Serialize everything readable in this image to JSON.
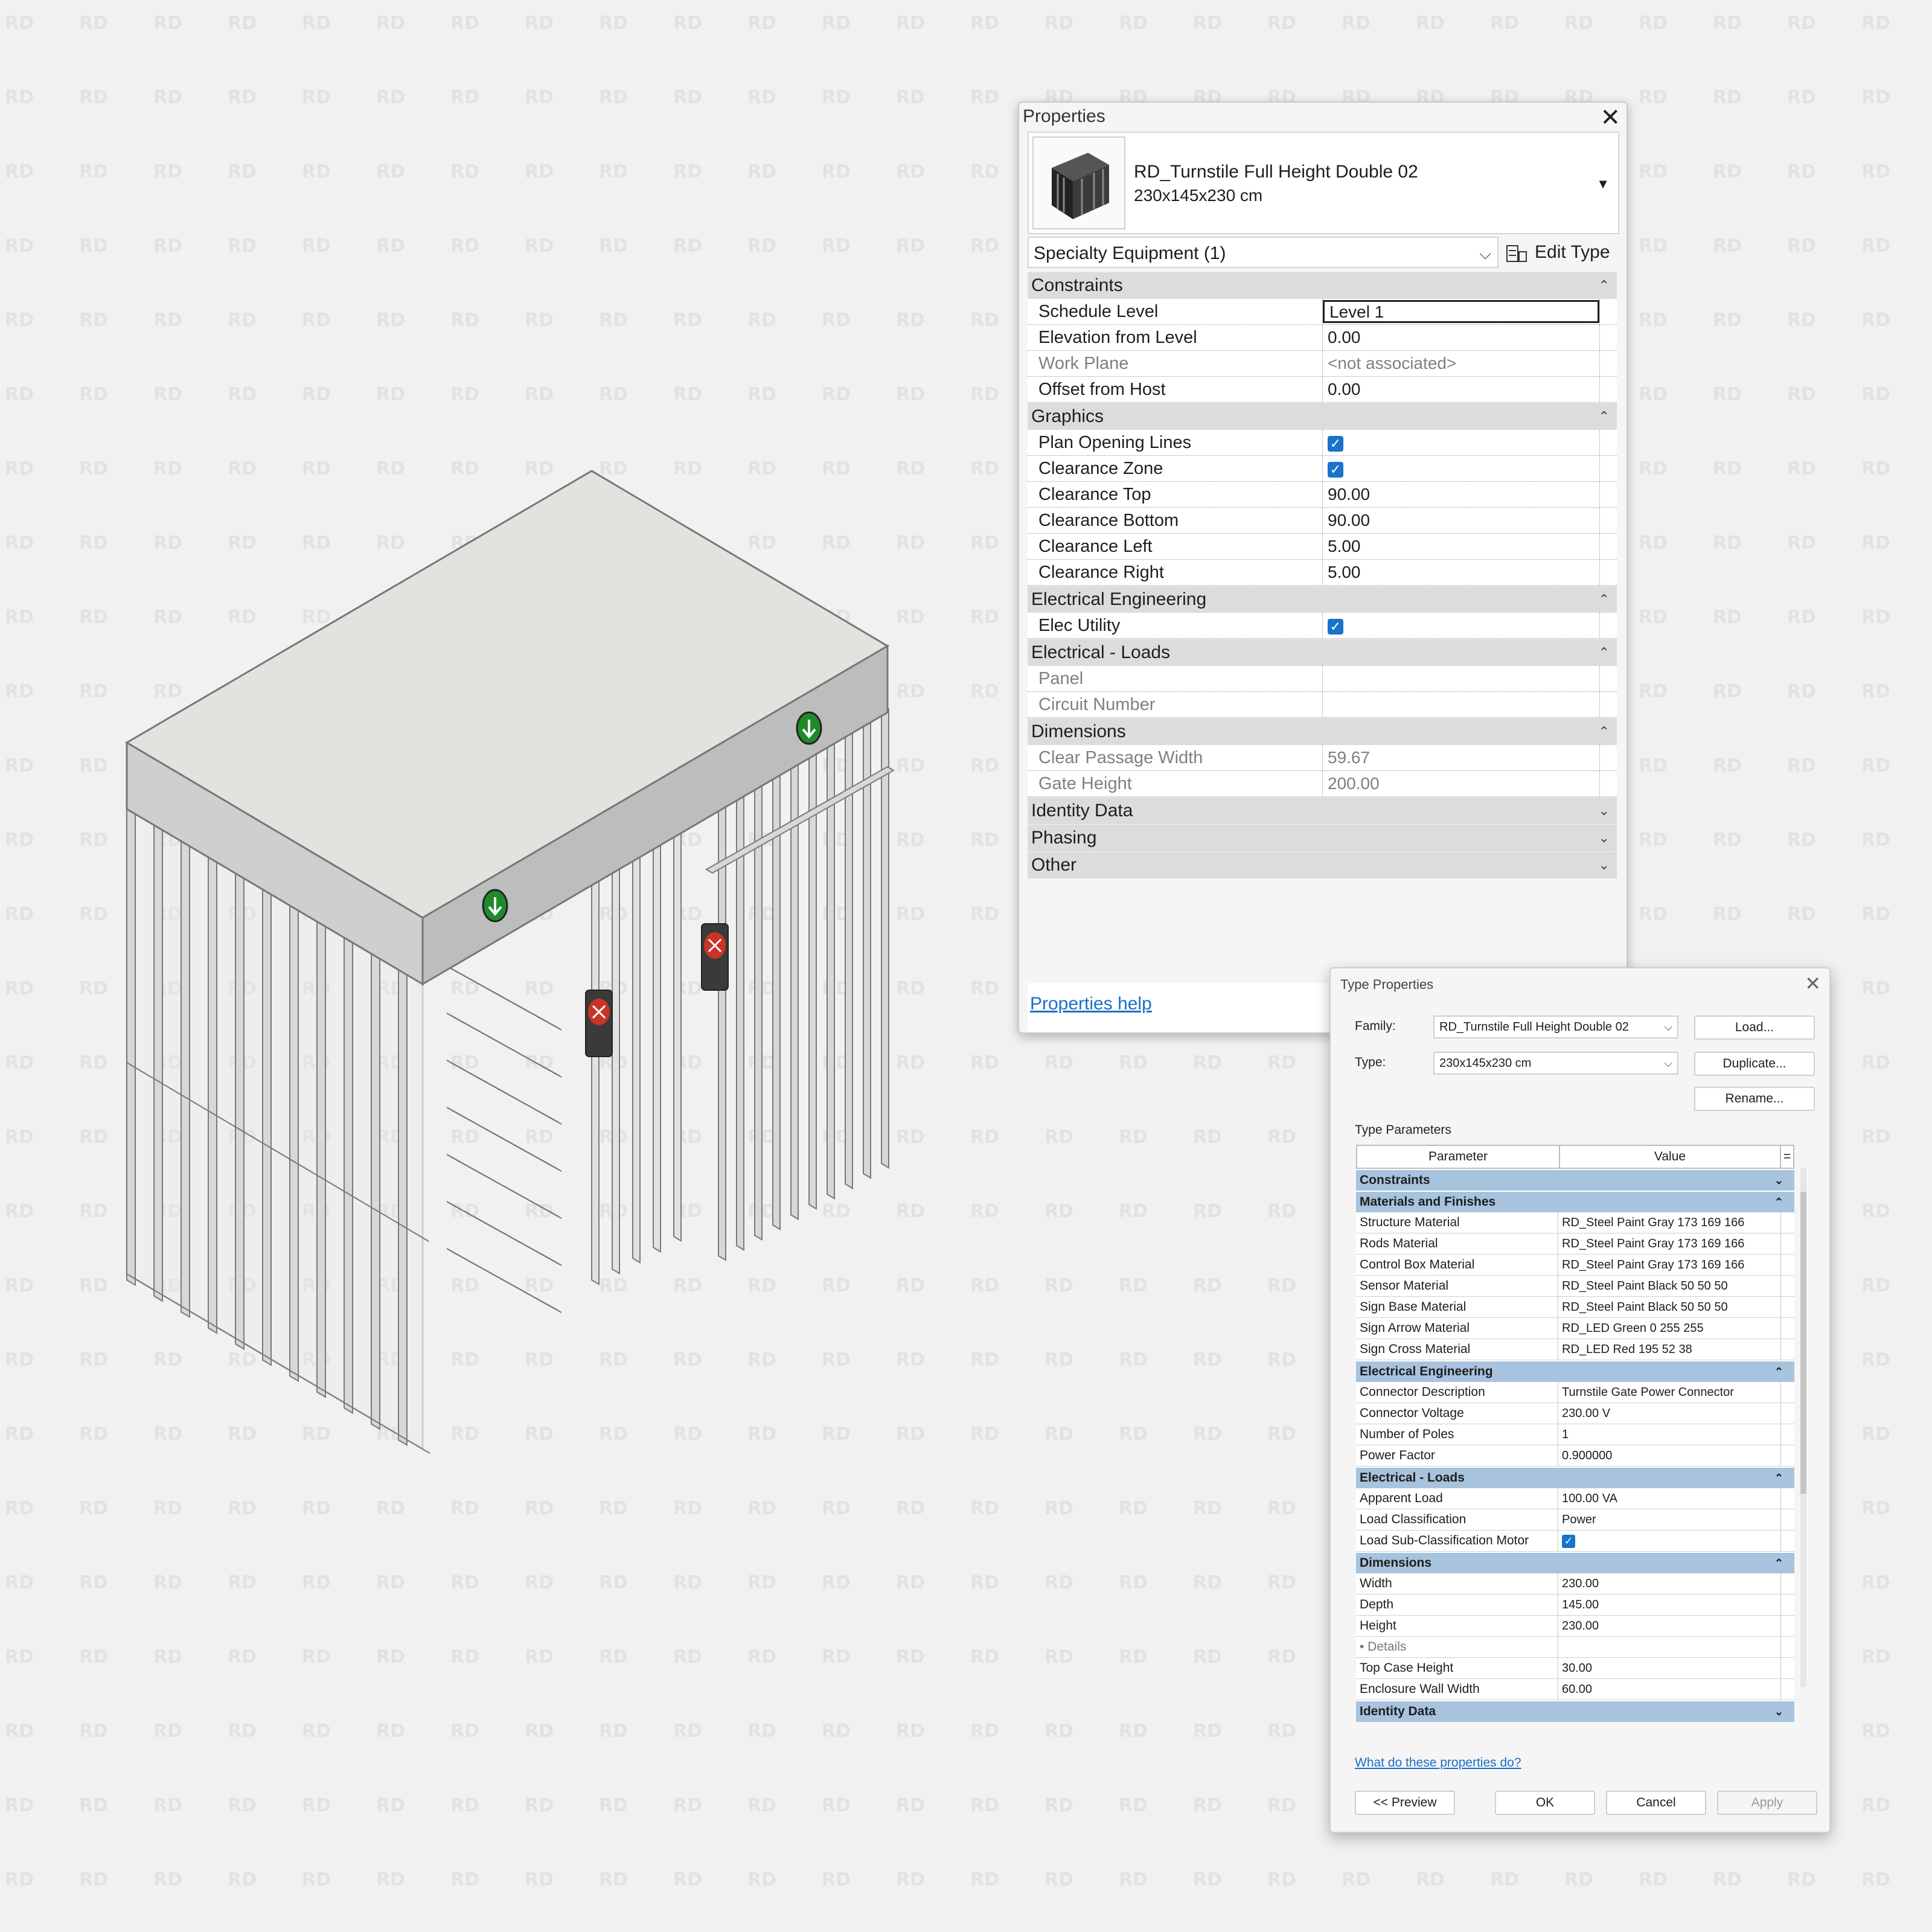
{
  "watermark": "RD",
  "properties": {
    "title": "Properties",
    "type_name": "RD_Turnstile Full Height Double 02",
    "type_size": "230x145x230 cm",
    "category_select": "Specialty Equipment (1)",
    "edit_type_label": "Edit Type",
    "help_link": "Properties help",
    "groups": {
      "constraints": "Constraints",
      "graphics": "Graphics",
      "electrical_engineering": "Electrical Engineering",
      "electrical_loads": "Electrical - Loads",
      "dimensions": "Dimensions",
      "identity_data": "Identity Data",
      "phasing": "Phasing",
      "other": "Other"
    },
    "rows": {
      "schedule_level": {
        "label": "Schedule Level",
        "value": "Level 1"
      },
      "elevation_from_level": {
        "label": "Elevation from Level",
        "value": "0.00"
      },
      "work_plane": {
        "label": "Work Plane",
        "value": "<not associated>"
      },
      "offset_from_host": {
        "label": "Offset from Host",
        "value": "0.00"
      },
      "plan_opening_lines": {
        "label": "Plan Opening Lines",
        "checked": true
      },
      "clearance_zone": {
        "label": "Clearance Zone",
        "checked": true
      },
      "clearance_top": {
        "label": "Clearance Top",
        "value": "90.00"
      },
      "clearance_bottom": {
        "label": "Clearance Bottom",
        "value": "90.00"
      },
      "clearance_left": {
        "label": "Clearance Left",
        "value": "5.00"
      },
      "clearance_right": {
        "label": "Clearance Right",
        "value": "5.00"
      },
      "elec_utility": {
        "label": "Elec Utility",
        "checked": true
      },
      "panel": {
        "label": "Panel",
        "value": ""
      },
      "circuit_number": {
        "label": "Circuit Number",
        "value": ""
      },
      "clear_passage_width": {
        "label": "Clear Passage Width",
        "value": "59.67"
      },
      "gate_height": {
        "label": "Gate Height",
        "value": "200.00"
      }
    }
  },
  "type_properties": {
    "title": "Type Properties",
    "family_label": "Family:",
    "family_value": "RD_Turnstile Full Height Double 02",
    "type_label": "Type:",
    "type_value": "230x145x230 cm",
    "load_button": "Load...",
    "duplicate_button": "Duplicate...",
    "rename_button": "Rename...",
    "type_parameters_label": "Type Parameters",
    "col_parameter": "Parameter",
    "col_value": "Value",
    "col_equals": "=",
    "groups": {
      "constraints": "Constraints",
      "materials": "Materials and Finishes",
      "electrical_engineering": "Electrical Engineering",
      "electrical_loads": "Electrical - Loads",
      "dimensions": "Dimensions",
      "identity_data": "Identity Data"
    },
    "materials_rows": [
      {
        "label": "Structure Material",
        "value": "RD_Steel Paint Gray 173 169 166"
      },
      {
        "label": "Rods Material",
        "value": "RD_Steel Paint Gray 173 169 166"
      },
      {
        "label": "Control Box Material",
        "value": "RD_Steel Paint Gray 173 169 166"
      },
      {
        "label": "Sensor Material",
        "value": "RD_Steel Paint Black 50 50 50"
      },
      {
        "label": "Sign Base Material",
        "value": "RD_Steel Paint Black 50 50 50"
      },
      {
        "label": "Sign Arrow Material",
        "value": "RD_LED Green 0 255 255"
      },
      {
        "label": "Sign Cross Material",
        "value": "RD_LED Red 195 52 38"
      }
    ],
    "electrical_rows": [
      {
        "label": "Connector Description",
        "value": "Turnstile Gate Power Connector"
      },
      {
        "label": "Connector Voltage",
        "value": "230.00 V"
      },
      {
        "label": "Number of Poles",
        "value": "1"
      },
      {
        "label": "Power Factor",
        "value": "0.900000"
      }
    ],
    "loads_rows": {
      "apparent_load": {
        "label": "Apparent Load",
        "value": "100.00 VA"
      },
      "load_classification": {
        "label": "Load Classification",
        "value": "Power"
      },
      "load_sub_motor": {
        "label": "Load Sub-Classification Motor",
        "checked": true
      }
    },
    "dimension_rows": {
      "width": {
        "label": "Width",
        "value": "230.00"
      },
      "depth": {
        "label": "Depth",
        "value": "145.00"
      },
      "height": {
        "label": "Height",
        "value": "230.00"
      },
      "details": {
        "label": "• Details",
        "value": ""
      },
      "top_case_height": {
        "label": "Top Case Height",
        "value": "30.00"
      },
      "enclosure_wall_width": {
        "label": "Enclosure Wall Width",
        "value": "60.00"
      }
    },
    "help_link": "What do these properties do?",
    "preview_button": "<< Preview",
    "ok_button": "OK",
    "cancel_button": "Cancel",
    "apply_button": "Apply"
  }
}
